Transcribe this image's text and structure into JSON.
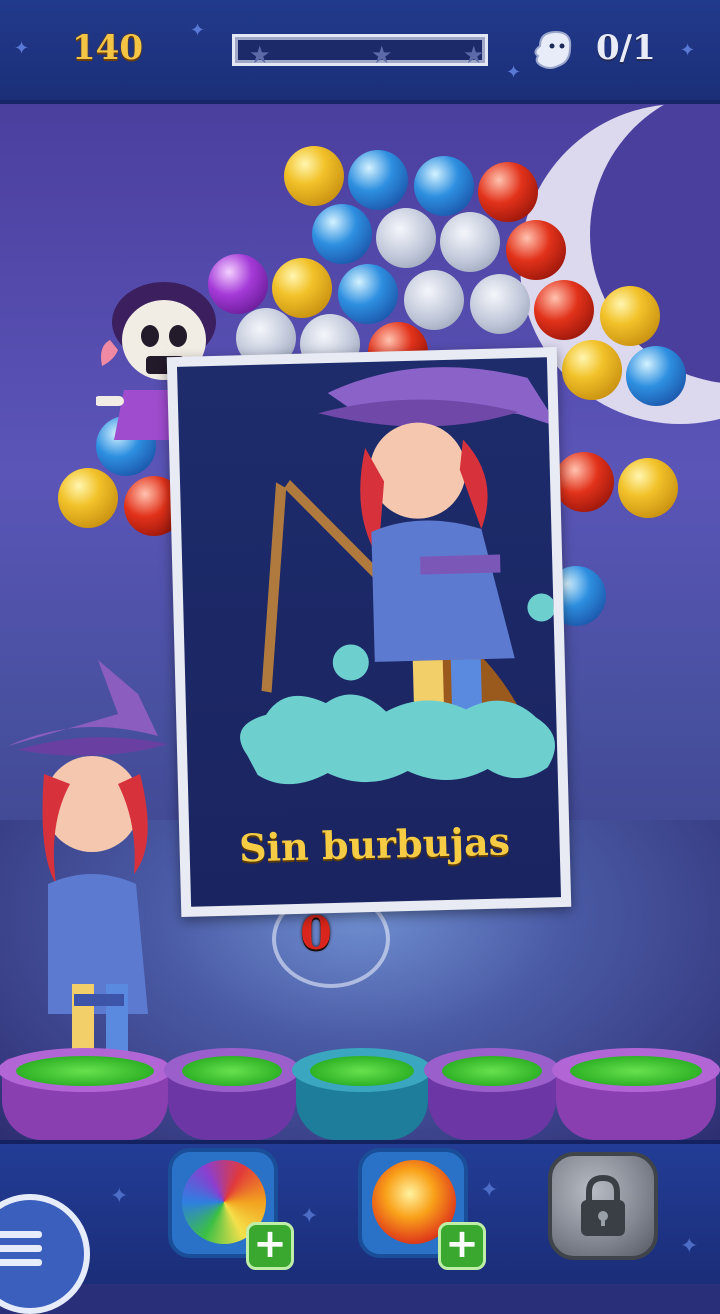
{
  "hud": {
    "score": "140",
    "progress_fraction": 0.0,
    "progress_stars": 3,
    "ghost_icon": "ghost-icon",
    "ghost_counter": "0/1"
  },
  "card": {
    "title": "Sin burbujas"
  },
  "bubbles_remaining": "0",
  "boosters": [
    {
      "name": "rainbow-bubble-booster",
      "icon": "rainbow-orb-icon",
      "has_plus": true
    },
    {
      "name": "fireball-booster",
      "icon": "fire-orb-icon",
      "has_plus": true
    },
    {
      "name": "locked-booster",
      "icon": "padlock-icon",
      "has_plus": false
    }
  ],
  "menu": {
    "icon": "hamburger-menu-icon"
  },
  "colors": {
    "score_gold": "#f4c545",
    "title_gold": "#f6cc45",
    "count_red": "#d9251b",
    "hud_blue": "#223a8c",
    "plus_green": "#3aa72e"
  }
}
